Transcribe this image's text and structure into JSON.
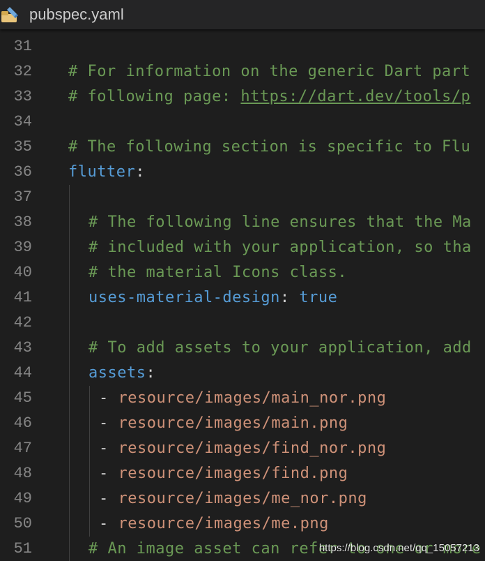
{
  "tab": {
    "title": "pubspec.yaml",
    "icon": "yaml-file-icon"
  },
  "colors": {
    "background": "#1e1e1e",
    "comment": "#6a9955",
    "key": "#569cd6",
    "string": "#ce9178",
    "line_number": "#858585"
  },
  "lines": [
    {
      "num": "31",
      "comment": "",
      "link": "",
      "key": "",
      "colon": "",
      "value": "",
      "dash": "",
      "str": ""
    },
    {
      "num": "32",
      "comment": "# For information on the generic Dart part",
      "link": "",
      "key": "",
      "colon": "",
      "value": "",
      "dash": "",
      "str": ""
    },
    {
      "num": "33",
      "comment": "# following page: ",
      "link": "https://dart.dev/tools/p",
      "key": "",
      "colon": "",
      "value": "",
      "dash": "",
      "str": ""
    },
    {
      "num": "34",
      "comment": "",
      "link": "",
      "key": "",
      "colon": "",
      "value": "",
      "dash": "",
      "str": ""
    },
    {
      "num": "35",
      "comment": "# The following section is specific to Flu",
      "link": "",
      "key": "",
      "colon": "",
      "value": "",
      "dash": "",
      "str": ""
    },
    {
      "num": "36",
      "comment": "",
      "link": "",
      "key": "flutter",
      "colon": ":",
      "value": "",
      "dash": "",
      "str": ""
    },
    {
      "num": "37",
      "comment": "",
      "link": "",
      "key": "",
      "colon": "",
      "value": "",
      "dash": "",
      "str": ""
    },
    {
      "num": "38",
      "comment": "# The following line ensures that the Ma",
      "link": "",
      "key": "",
      "colon": "",
      "value": "",
      "dash": "",
      "str": ""
    },
    {
      "num": "39",
      "comment": "# included with your application, so tha",
      "link": "",
      "key": "",
      "colon": "",
      "value": "",
      "dash": "",
      "str": ""
    },
    {
      "num": "40",
      "comment": "# the material Icons class.",
      "link": "",
      "key": "",
      "colon": "",
      "value": "",
      "dash": "",
      "str": ""
    },
    {
      "num": "41",
      "comment": "",
      "link": "",
      "key": "uses-material-design",
      "colon": ": ",
      "value": "true",
      "dash": "",
      "str": ""
    },
    {
      "num": "42",
      "comment": "",
      "link": "",
      "key": "",
      "colon": "",
      "value": "",
      "dash": "",
      "str": ""
    },
    {
      "num": "43",
      "comment": "# To add assets to your application, add",
      "link": "",
      "key": "",
      "colon": "",
      "value": "",
      "dash": "",
      "str": ""
    },
    {
      "num": "44",
      "comment": "",
      "link": "",
      "key": "assets",
      "colon": ":",
      "value": "",
      "dash": "",
      "str": ""
    },
    {
      "num": "45",
      "comment": "",
      "link": "",
      "key": "",
      "colon": "",
      "value": "",
      "dash": "- ",
      "str": "resource/images/main_nor.png"
    },
    {
      "num": "46",
      "comment": "",
      "link": "",
      "key": "",
      "colon": "",
      "value": "",
      "dash": "- ",
      "str": "resource/images/main.png"
    },
    {
      "num": "47",
      "comment": "",
      "link": "",
      "key": "",
      "colon": "",
      "value": "",
      "dash": "- ",
      "str": "resource/images/find_nor.png"
    },
    {
      "num": "48",
      "comment": "",
      "link": "",
      "key": "",
      "colon": "",
      "value": "",
      "dash": "- ",
      "str": "resource/images/find.png"
    },
    {
      "num": "49",
      "comment": "",
      "link": "",
      "key": "",
      "colon": "",
      "value": "",
      "dash": "- ",
      "str": "resource/images/me_nor.png"
    },
    {
      "num": "50",
      "comment": "",
      "link": "",
      "key": "",
      "colon": "",
      "value": "",
      "dash": "- ",
      "str": "resource/images/me.png"
    },
    {
      "num": "51",
      "comment": "# An image asset can refer to one or more",
      "link": "",
      "key": "",
      "colon": "",
      "value": "",
      "dash": "",
      "str": ""
    }
  ],
  "watermark": "https://blog.csdn.net/qq_15057213"
}
